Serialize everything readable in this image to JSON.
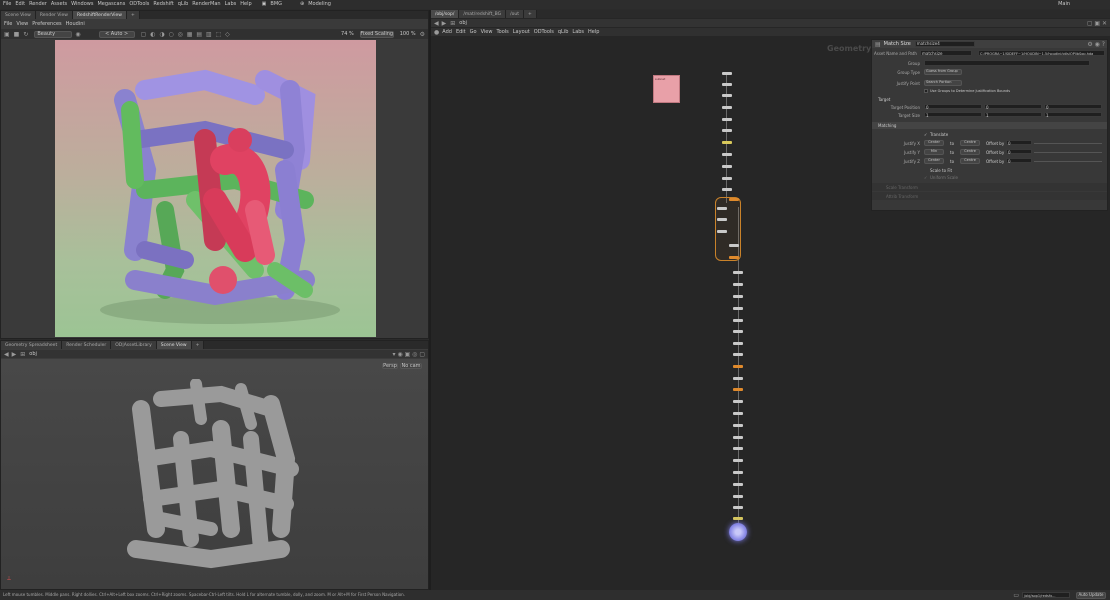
{
  "menubar": {
    "items": [
      "File",
      "Edit",
      "Render",
      "Assets",
      "Windows",
      "Megascans",
      "ODTools",
      "Redshift",
      "qLib",
      "RenderMan",
      "Labs",
      "Help"
    ],
    "desktop": "BMG",
    "build": "Modeling",
    "right_label": "Main"
  },
  "left_top": {
    "tabs": [
      "Scene View",
      "Render View",
      "RedshiftRenderView"
    ],
    "menu": [
      "File",
      "View",
      "Preferences",
      "Houdini"
    ],
    "aov": "Beauty",
    "camera": "< Auto >",
    "zoom": "74 %",
    "scaling": "Fixed Scaling",
    "scale_pct": "100 %"
  },
  "left_bottom": {
    "tabs": [
      "Geometry Spreadsheet",
      "Render Scheduler",
      "OD|AssetLibrary",
      "Scene View"
    ],
    "path": "obj",
    "persp_btn": "Persp",
    "camera_btn": "No cam"
  },
  "right_network": {
    "tabs": [
      "/obj/sop/",
      "/mat/redshift_BG",
      "/out"
    ],
    "path": "obj",
    "menu": [
      "Add",
      "Edit",
      "Go",
      "View",
      "Tools",
      "Layout",
      "ODTools",
      "qLib",
      "Labs",
      "Help"
    ],
    "context_label": "Geometry",
    "sticky_label": "subnet"
  },
  "parameters": {
    "node_type": "Match Size",
    "node_name": "matchsize4",
    "asset_label": "Asset Name and Path",
    "asset_name": "matchsize",
    "asset_path": "C:/PROGRA~1/SIDEFF~1/HOUDIN~1.5/houdini/otls/OPlibSop.hda",
    "group_label": "Group",
    "group_type_label": "Group Type",
    "group_type_value": "Guess from Group",
    "justify_from_label": "Justify Point",
    "justify_from_value": "Search Portion",
    "use_groups_label": "Use Groups to Determine Justification Bounds",
    "target_section": "Target",
    "target_pos_label": "Target Position",
    "target_pos": [
      "0",
      "0",
      "0"
    ],
    "target_size_label": "Target Size",
    "target_size": [
      "1",
      "1",
      "1"
    ],
    "matching_section": "Matching",
    "translate_label": "Translate",
    "justify_rows": [
      {
        "label": "Justify X",
        "mode": "Center",
        "to": "to",
        "target": "Centre",
        "offset_label": "Offset by",
        "offset": "0"
      },
      {
        "label": "Justify Y",
        "mode": "Min",
        "to": "to",
        "target": "Centre",
        "offset_label": "Offset by",
        "offset": "0"
      },
      {
        "label": "Justify Z",
        "mode": "Center",
        "to": "to",
        "target": "Centre",
        "offset_label": "Offset by",
        "offset": "0"
      }
    ],
    "scale_label": "Scale to Fit",
    "uniform_label": "Uniform Scale",
    "disabled_rows": [
      "Scale Transform",
      "Attrib Transform"
    ]
  },
  "statusbar": {
    "hint": "Left mouse tumbles. Middle pans. Right dollies. Ctrl+Alt+Left box zooms. Ctrl+Right zooms. Spacebar-Ctrl-Left tilts. Hold L for alternate tumble, dolly, and zoom.    M or Alt+M for First Person Navigation.",
    "path": "/obj/sop1/redsfx...",
    "update": "Auto Update"
  },
  "colors": {
    "accent_orange": "#e08a2c",
    "sticky_pink": "#e8a0a8",
    "output_node_blue": "#8a8ae6"
  }
}
